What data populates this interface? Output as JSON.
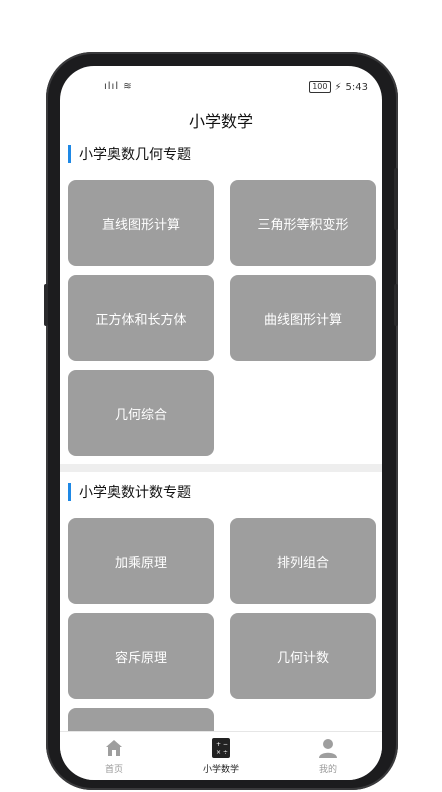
{
  "status": {
    "signal": "ılıl ≋",
    "battery": "100",
    "time": "5:43"
  },
  "header": {
    "title": "小学数学"
  },
  "sections": [
    {
      "title": "小学奥数几何专题",
      "items": [
        "直线图形计算",
        "三角形等积变形",
        "正方体和长方体",
        "曲线图形计算",
        "几何综合"
      ]
    },
    {
      "title": "小学奥数计数专题",
      "items": [
        "加乘原理",
        "排列组合",
        "容斥原理",
        "几何计数"
      ]
    }
  ],
  "tabbar": {
    "items": [
      {
        "label": "首页",
        "icon": "home-icon"
      },
      {
        "label": "小学数学",
        "icon": "calculator-icon"
      },
      {
        "label": "我的",
        "icon": "user-icon"
      }
    ]
  },
  "colors": {
    "accent": "#1e88e5",
    "card": "#9e9e9e"
  }
}
